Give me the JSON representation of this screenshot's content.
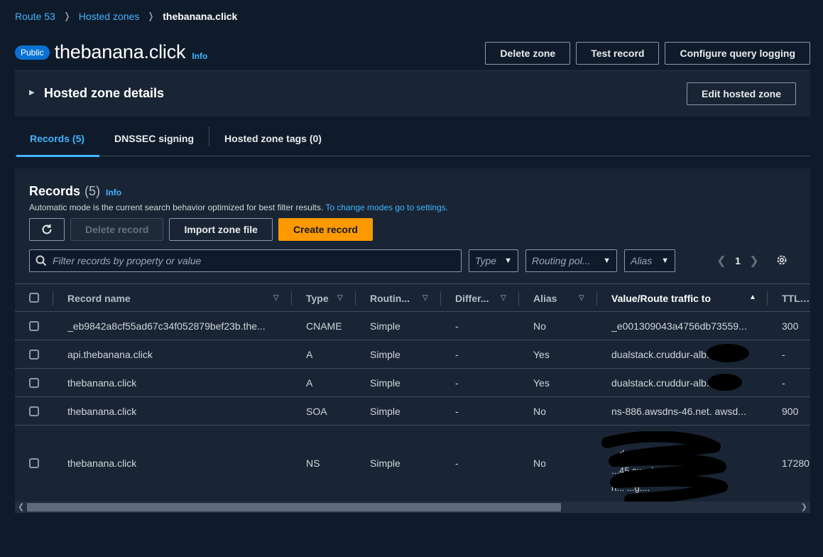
{
  "breadcrumb": {
    "items": [
      "Route 53",
      "Hosted zones"
    ],
    "current": "thebanana.click"
  },
  "header": {
    "badge": "Public",
    "title": "thebanana.click",
    "info": "Info",
    "actions": [
      "Delete zone",
      "Test record",
      "Configure query logging"
    ]
  },
  "details": {
    "title": "Hosted zone details",
    "edit_button": "Edit hosted zone"
  },
  "tabs": [
    {
      "label": "Records (5)",
      "active": true
    },
    {
      "label": "DNSSEC signing",
      "active": false
    },
    {
      "label": "Hosted zone tags (0)",
      "active": false
    }
  ],
  "records": {
    "title": "Records",
    "count": "(5)",
    "info": "Info",
    "description": "Automatic mode is the current search behavior optimized for best filter results.",
    "description_link": "To change modes go to settings.",
    "buttons": {
      "delete": "Delete record",
      "import": "Import zone file",
      "create": "Create record"
    },
    "search_placeholder": "Filter records by property or value",
    "filters": {
      "type": "Type",
      "routing": "Routing pol...",
      "alias": "Alias"
    },
    "page": "1",
    "columns": [
      "Record name",
      "Type",
      "Routin...",
      "Differ...",
      "Alias",
      "Value/Route traffic to",
      "TTL (s"
    ],
    "rows": [
      {
        "name": "_eb9842a8cf55ad67c34f052879bef23b.the...",
        "type": "CNAME",
        "routing": "Simple",
        "differ": "-",
        "alias": "No",
        "value": "_e001309043a4756db73559...",
        "ttl": "300"
      },
      {
        "name": "api.thebanana.click",
        "type": "A",
        "routing": "Simple",
        "differ": "-",
        "alias": "Yes",
        "value": "dualstack.cruddur-alb...",
        "ttl": "-"
      },
      {
        "name": "thebanana.click",
        "type": "A",
        "routing": "Simple",
        "differ": "-",
        "alias": "Yes",
        "value": "dualstack.cruddur-alb...",
        "ttl": "-"
      },
      {
        "name": "thebanana.click",
        "type": "SOA",
        "routing": "Simple",
        "differ": "-",
        "alias": "No",
        "value": "ns-886.awsdns-46.net. awsd...",
        "ttl": "900"
      },
      {
        "name": "thebanana.click",
        "type": "NS",
        "routing": "Simple",
        "differ": "-",
        "alias": "No",
        "value_lines": [
          "...dns-62...",
          "...45.awsdn...om.",
          "n... ...g...."
        ],
        "ttl": "17280"
      }
    ]
  }
}
